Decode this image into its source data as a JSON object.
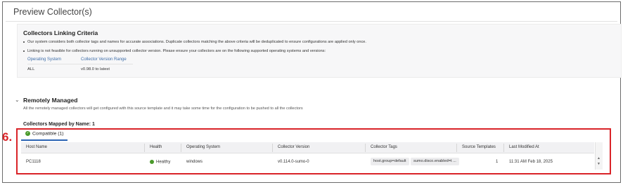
{
  "page": {
    "title": "Preview Collector(s)"
  },
  "criteria": {
    "title": "Collectors Linking Criteria",
    "bullet1": "Our system considers both collector tags and names for accurate associations. Duplicate collectors matching the above criteria will be deduplicated to ensure configurations are applied only once.",
    "bullet2": "Linking is not feasible for collectors running on unsupported collector version. Please ensure your collectors are on the following supported operating systems and versions:",
    "table": {
      "headers": [
        "Operating System",
        "Collector Version Range"
      ],
      "rows": [
        [
          "ALL",
          "v0.98.0 to latest"
        ]
      ]
    }
  },
  "remote": {
    "title": "Remotely Managed",
    "description": "All the remotely managed collectors will get configured with this source template and it may take some time for the configuration to be pushed to all the collectors"
  },
  "mapped": {
    "label": "Collectors Mapped by Name: 1"
  },
  "step": "6.",
  "tab": {
    "label": "Compatible (1)"
  },
  "table": {
    "headers": {
      "host": "Host Name",
      "health": "Health",
      "os": "Operating System",
      "version": "Collector Version",
      "tags": "Collector Tags",
      "templates": "Source Templates",
      "modified": "Last Modified At"
    },
    "rows": [
      {
        "host": "PC1118",
        "health": "Healthy",
        "os": "windows",
        "version": "v0.114.0-sumo-0",
        "tag1": "host.group=default",
        "tag2": "sumo.disco.enabled=t ...",
        "templates": "1",
        "modified": "11:31 AM Feb 18, 2025"
      }
    ]
  },
  "colors": {
    "accent": "#2b64b4",
    "highlight": "#d92328",
    "healthy": "#4a9a2a"
  }
}
